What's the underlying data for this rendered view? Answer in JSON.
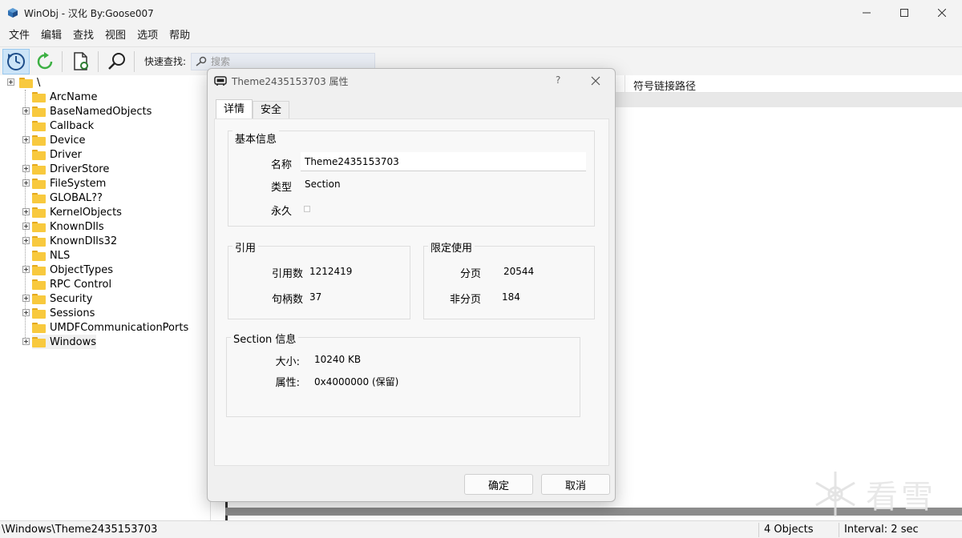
{
  "window": {
    "title": "WinObj - 汉化 By:Goose007"
  },
  "menu": [
    "文件",
    "编辑",
    "查找",
    "视图",
    "选项",
    "帮助"
  ],
  "toolbar": {
    "quick_find_label": "快速查找:",
    "search_placeholder": "搜索"
  },
  "tree": {
    "root": "\\",
    "items": [
      {
        "label": "ArcName",
        "expandable": false
      },
      {
        "label": "BaseNamedObjects",
        "expandable": true
      },
      {
        "label": "Callback",
        "expandable": false
      },
      {
        "label": "Device",
        "expandable": true
      },
      {
        "label": "Driver",
        "expandable": false
      },
      {
        "label": "DriverStore",
        "expandable": true
      },
      {
        "label": "FileSystem",
        "expandable": true
      },
      {
        "label": "GLOBAL??",
        "expandable": false
      },
      {
        "label": "KernelObjects",
        "expandable": true
      },
      {
        "label": "KnownDlls",
        "expandable": true
      },
      {
        "label": "KnownDlls32",
        "expandable": true
      },
      {
        "label": "NLS",
        "expandable": false
      },
      {
        "label": "ObjectTypes",
        "expandable": true
      },
      {
        "label": "RPC Control",
        "expandable": false
      },
      {
        "label": "Security",
        "expandable": true
      },
      {
        "label": "Sessions",
        "expandable": true
      },
      {
        "label": "UMDFCommunicationPorts",
        "expandable": false
      },
      {
        "label": "Windows",
        "expandable": true
      }
    ]
  },
  "list": {
    "columns": [
      "符号链接路径"
    ]
  },
  "status": {
    "path": "\\Windows\\Theme2435153703",
    "objects": "4 Objects",
    "interval": "Interval: 2 sec"
  },
  "dialog": {
    "title": "Theme2435153703 属性",
    "help": "?",
    "tabs": [
      "详情",
      "安全"
    ],
    "basic": {
      "title": "基本信息",
      "name_label": "名称",
      "name_value": "Theme2435153703",
      "type_label": "类型",
      "type_value": "Section",
      "permanent_label": "永久"
    },
    "refs": {
      "title": "引用",
      "ref_count_label": "引用数",
      "ref_count_value": "1212419",
      "handle_count_label": "句柄数",
      "handle_count_value": "37"
    },
    "quota": {
      "title": "限定使用",
      "paged_label": "分页",
      "paged_value": "20544",
      "nonpaged_label": "非分页",
      "nonpaged_value": "184"
    },
    "section": {
      "title": "Section 信息",
      "size_label": "大小:",
      "size_value": "10240 KB",
      "attr_label": "属性:",
      "attr_value": "0x4000000 (保留)"
    },
    "ok_label": "确定",
    "cancel_label": "取消"
  },
  "watermark": {
    "text": "看雪"
  }
}
